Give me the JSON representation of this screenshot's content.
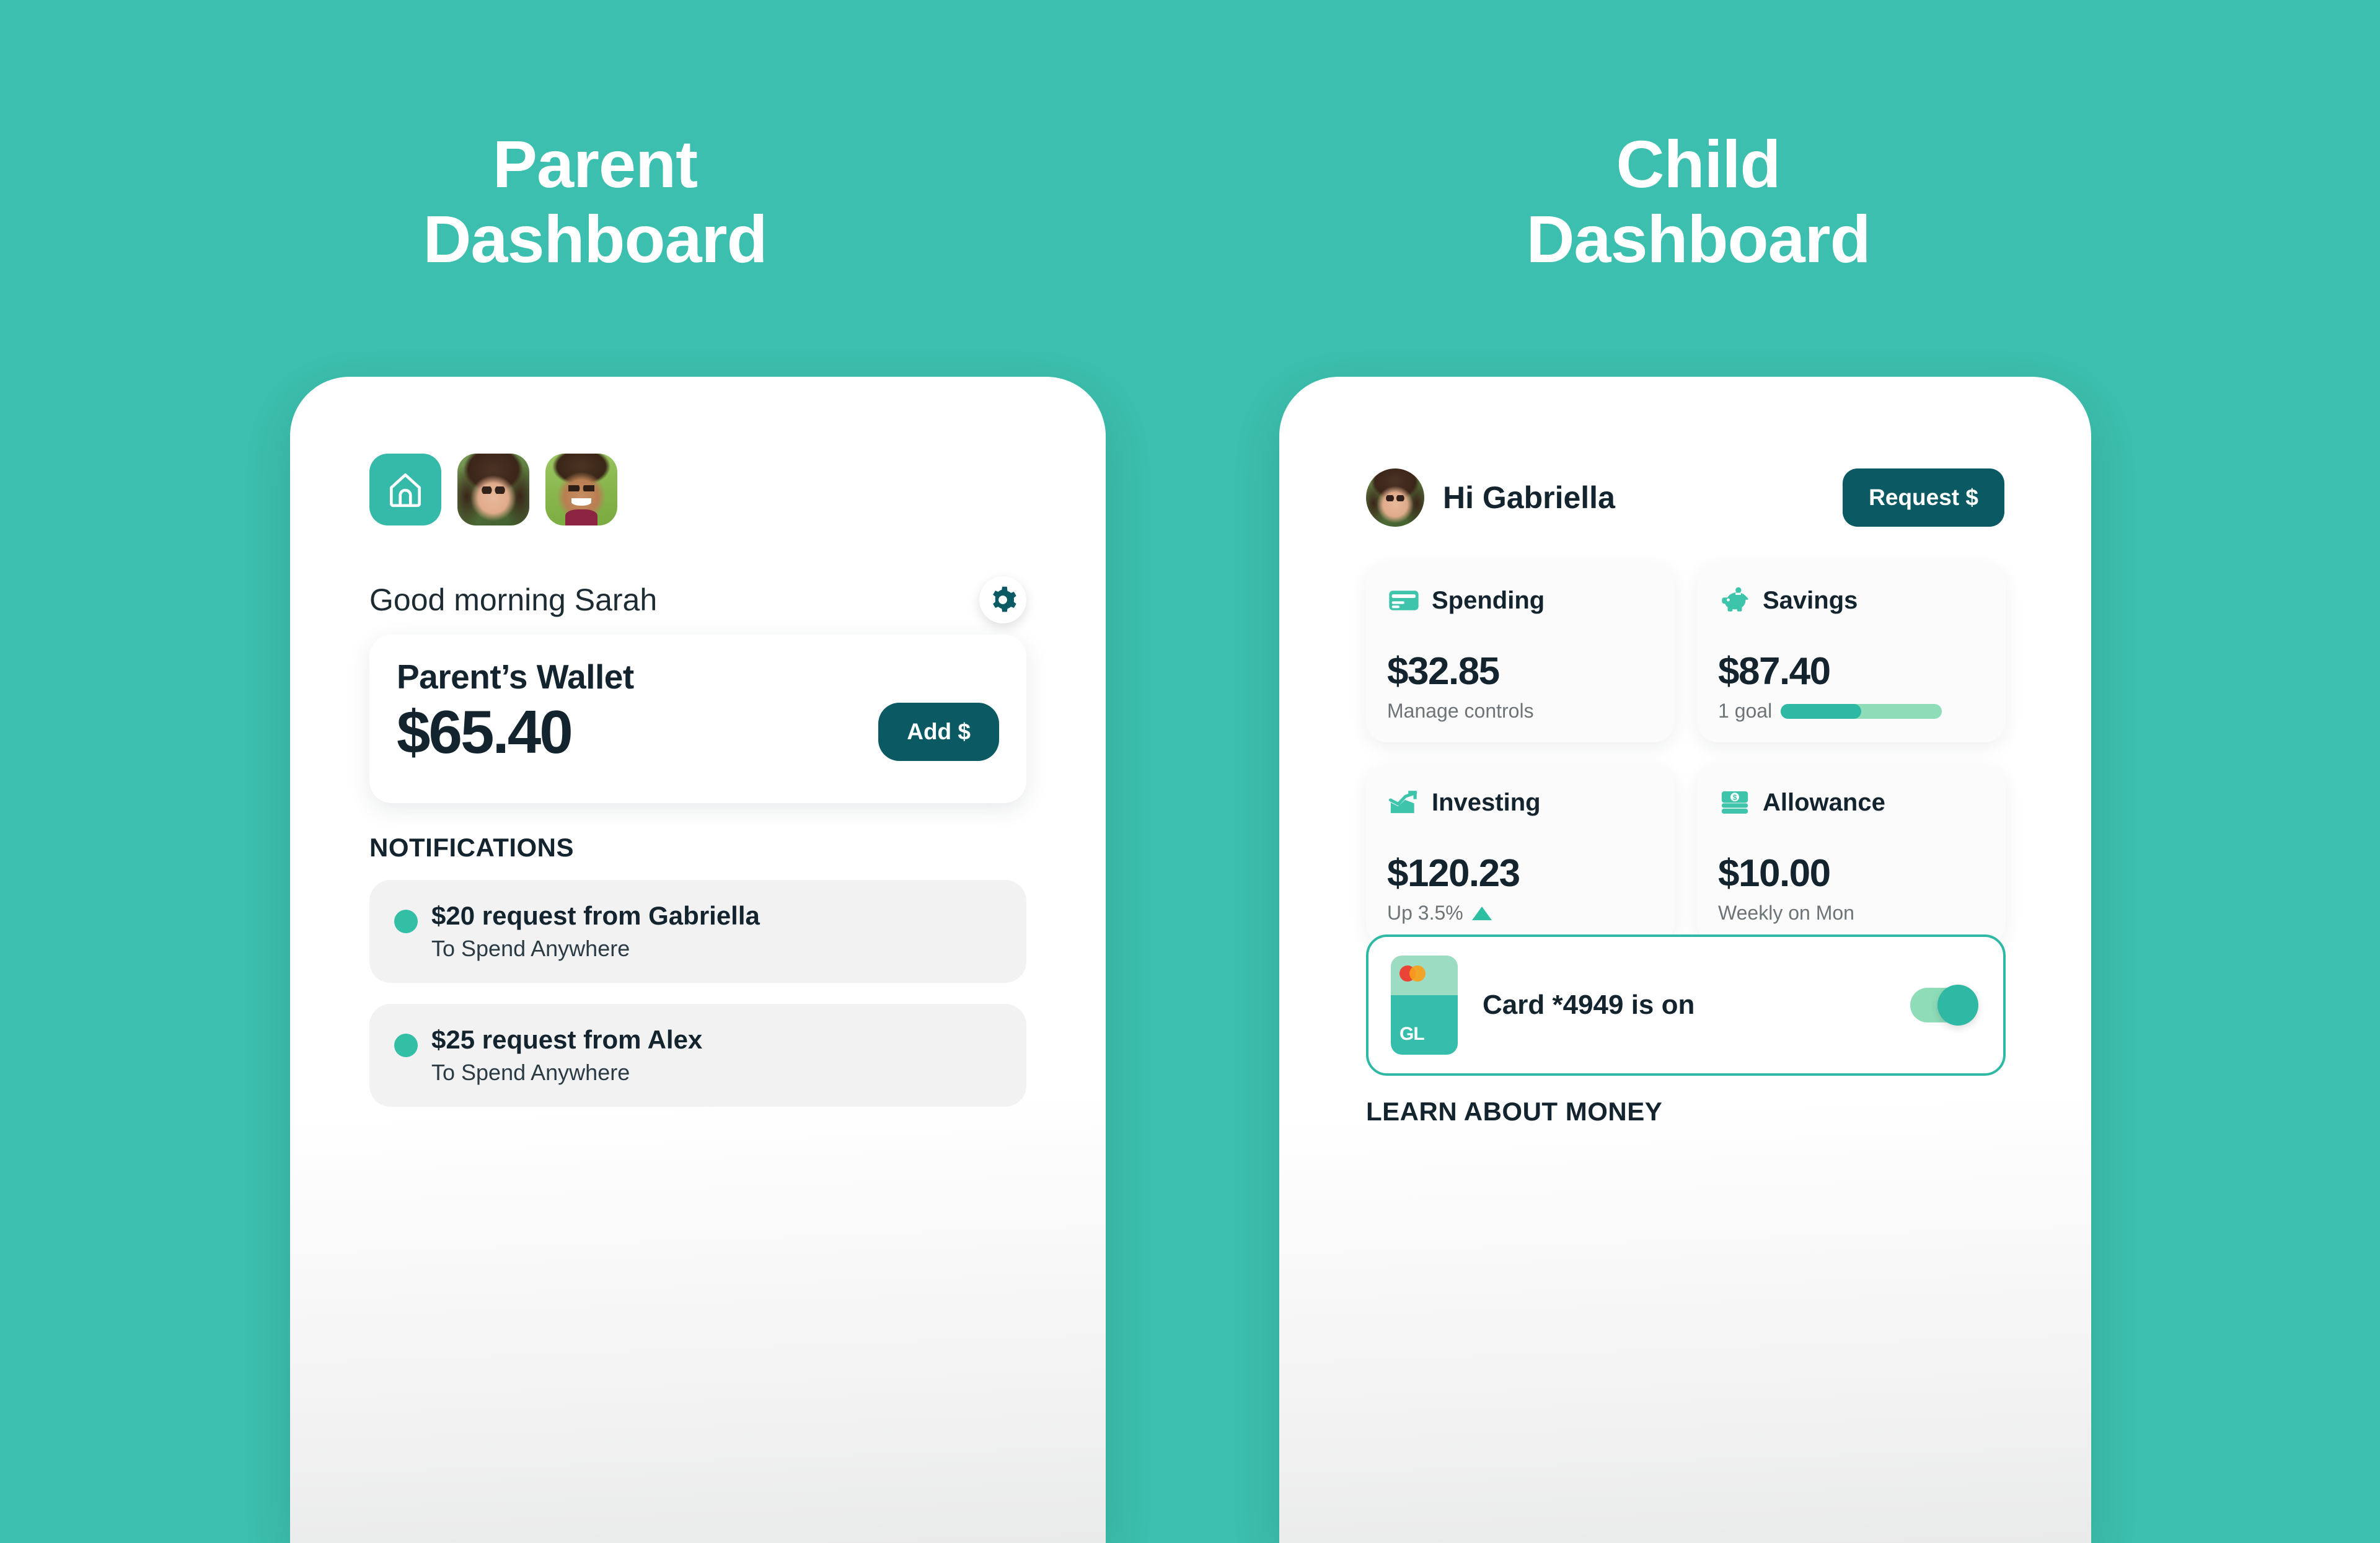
{
  "theme": {
    "background": "#3cbfae",
    "accent_teal": "#2fb9a4",
    "deep_teal": "#0b5a63",
    "ink": "#14242e",
    "muted": "#6d7478"
  },
  "headings": {
    "parent_line1": "Parent",
    "parent_line2": "Dashboard",
    "child_line1": "Child",
    "child_line2": "Dashboard"
  },
  "parent": {
    "avatars": [
      {
        "name": "home-tile",
        "type": "icon",
        "icon": "home-icon"
      },
      {
        "name": "gabriella-avatar",
        "type": "photo"
      },
      {
        "name": "alex-avatar",
        "type": "photo"
      }
    ],
    "greeting": "Good morning Sarah",
    "settings_icon": "gear-icon",
    "wallet": {
      "title": "Parent’s Wallet",
      "amount": "$65.40",
      "add_label": "Add $"
    },
    "notifications_heading": "NOTIFICATIONS",
    "notifications": [
      {
        "title": "$20 request from Gabriella",
        "subtitle": "To Spend Anywhere"
      },
      {
        "title": "$25 request from Alex",
        "subtitle": "To Spend Anywhere"
      }
    ]
  },
  "child": {
    "greeting": "Hi Gabriella",
    "request_label": "Request $",
    "stats": [
      {
        "label": "Spending",
        "icon": "credit-card-icon",
        "amount": "$32.85",
        "sub": "Manage controls",
        "sub_type": "text"
      },
      {
        "label": "Savings",
        "icon": "piggy-bank-icon",
        "amount": "$87.40",
        "sub": "1 goal",
        "sub_type": "progress",
        "progress_percent": 50
      },
      {
        "label": "Investing",
        "icon": "trend-up-icon",
        "amount": "$120.23",
        "sub": "Up 3.5%",
        "sub_type": "trend-up"
      },
      {
        "label": "Allowance",
        "icon": "cash-stack-icon",
        "amount": "$10.00",
        "sub": "Weekly on Mon",
        "sub_type": "text"
      }
    ],
    "card": {
      "brand_mark": "mastercard-logo",
      "card_initials": "GL",
      "status_text": "Card *4949 is on",
      "toggle_state": "on"
    },
    "learn_heading": "LEARN ABOUT MONEY"
  }
}
